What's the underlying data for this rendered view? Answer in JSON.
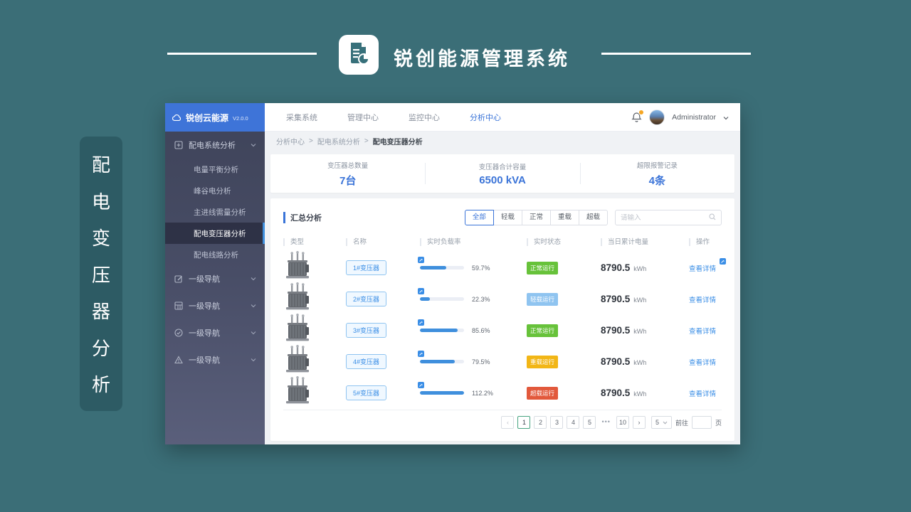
{
  "slide": {
    "title": "锐创能源管理系统",
    "vertical_chars": [
      "配",
      "电",
      "变",
      "压",
      "器",
      "分",
      "析"
    ]
  },
  "app": {
    "sidebar": {
      "logo_name": "锐创云能源",
      "logo_version": "V2.0.0",
      "group1_label": "配电系统分析",
      "sub_items": [
        "电量平衡分析",
        "峰谷电分析",
        "主进线需量分析",
        "配电变压器分析",
        "配电线路分析"
      ],
      "active_sub_item": "配电变压器分析",
      "nav_groups": [
        "一级导航",
        "一级导航",
        "一级导航",
        "一级导航"
      ]
    },
    "topbar": {
      "nav": [
        "采集系统",
        "管理中心",
        "监控中心",
        "分析中心"
      ],
      "active_nav": "分析中心",
      "user": "Administrator"
    },
    "breadcrumb": {
      "items": [
        "分析中心",
        "配电系统分析",
        "配电变压器分析"
      ],
      "sep": ">"
    },
    "stats": [
      {
        "label": "变压器总数量",
        "value": "7台"
      },
      {
        "label": "变压器合计容量",
        "value": "6500 kVA"
      },
      {
        "label": "超限报警记录",
        "value": "4条"
      }
    ],
    "panel": {
      "title": "汇总分析",
      "filters": [
        "全部",
        "轻载",
        "正常",
        "重载",
        "超载"
      ],
      "active_filter": "全部",
      "search_placeholder": "请输入",
      "table": {
        "headers": [
          "类型",
          "名称",
          "实时负载率",
          "实时状态",
          "当日累计电量",
          "操作"
        ],
        "rows": [
          {
            "name": "1#变压器",
            "load": "59.7%",
            "status": "正常运行",
            "status_type": "success",
            "energy": "8790.5",
            "unit": "kWh",
            "action": "查看详情"
          },
          {
            "name": "2#变压器",
            "load": "22.3%",
            "status": "轻载运行",
            "status_type": "info",
            "energy": "8790.5",
            "unit": "kWh",
            "action": "查看详情"
          },
          {
            "name": "3#变压器",
            "load": "85.6%",
            "status": "正常运行",
            "status_type": "success",
            "energy": "8790.5",
            "unit": "kWh",
            "action": "查看详情"
          },
          {
            "name": "4#变压器",
            "load": "79.5%",
            "status": "重载运行",
            "status_type": "warning",
            "energy": "8790.5",
            "unit": "kWh",
            "action": "查看详情"
          },
          {
            "name": "5#变压器",
            "load": "112.2%",
            "status": "超载运行",
            "status_type": "danger",
            "energy": "8790.5",
            "unit": "kWh",
            "action": "查看详情"
          }
        ]
      },
      "pagination": {
        "prev": "‹",
        "next": "›",
        "pages": [
          "1",
          "2",
          "3",
          "4",
          "5",
          "•••",
          "10"
        ],
        "active_page": "1",
        "page_size": "5",
        "goto_label": "前往",
        "goto_suffix": "页"
      }
    }
  },
  "colors": {
    "page_teal": "#3B6E77",
    "accent_blue": "#3A74D8",
    "link_blue": "#3A8EE6",
    "status_success": "#67C23A",
    "status_info": "#8FC4F0",
    "status_warning": "#F2B616",
    "status_danger": "#E2593C"
  }
}
